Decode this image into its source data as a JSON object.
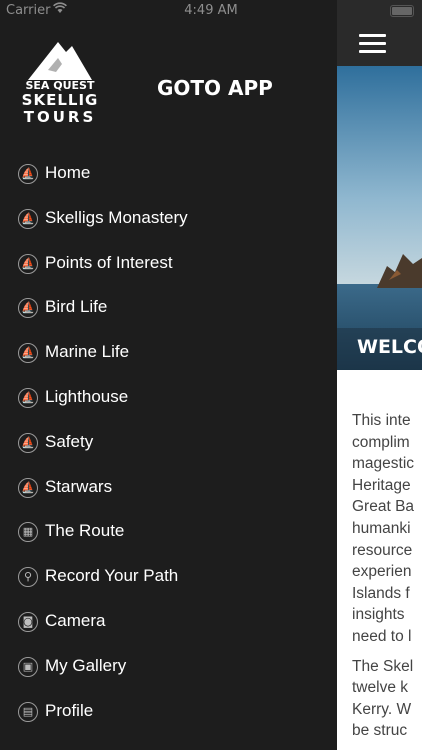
{
  "status_bar": {
    "carrier": "Carrier",
    "time": "4:49 AM"
  },
  "drawer": {
    "logo": {
      "line1": "SEA QUEST",
      "line2": "SKELLIG",
      "line3": "TOURS"
    },
    "goto_app": "GOTO APP",
    "items": [
      {
        "label": "Home",
        "icon": "compass-icon"
      },
      {
        "label": "Skelligs Monastery",
        "icon": "compass-icon"
      },
      {
        "label": "Points of Interest",
        "icon": "compass-icon"
      },
      {
        "label": "Bird Life",
        "icon": "compass-icon"
      },
      {
        "label": "Marine Life",
        "icon": "compass-icon"
      },
      {
        "label": "Lighthouse",
        "icon": "compass-icon"
      },
      {
        "label": "Safety",
        "icon": "compass-icon"
      },
      {
        "label": "Starwars",
        "icon": "compass-icon"
      },
      {
        "label": "The Route",
        "icon": "map-icon"
      },
      {
        "label": "Record Your Path",
        "icon": "location-pin-icon"
      },
      {
        "label": "Camera",
        "icon": "camera-icon"
      },
      {
        "label": "My Gallery",
        "icon": "gallery-icon"
      },
      {
        "label": "Profile",
        "icon": "id-card-icon"
      }
    ]
  },
  "content": {
    "welcome": "WELCO",
    "paragraph1_lines": [
      "This inte",
      "complim",
      "magestic",
      "Heritage",
      "Great Ba",
      "humanki",
      "resource",
      "experien",
      "Islands f",
      "insights",
      "need to l"
    ],
    "paragraph2_lines": [
      "The Skel",
      "twelve k",
      "Kerry. W",
      "be struc"
    ]
  },
  "colors": {
    "drawer_bg": "#1d1d1d",
    "topbar_bg": "#2a2a2a",
    "text": "#ffffff"
  }
}
